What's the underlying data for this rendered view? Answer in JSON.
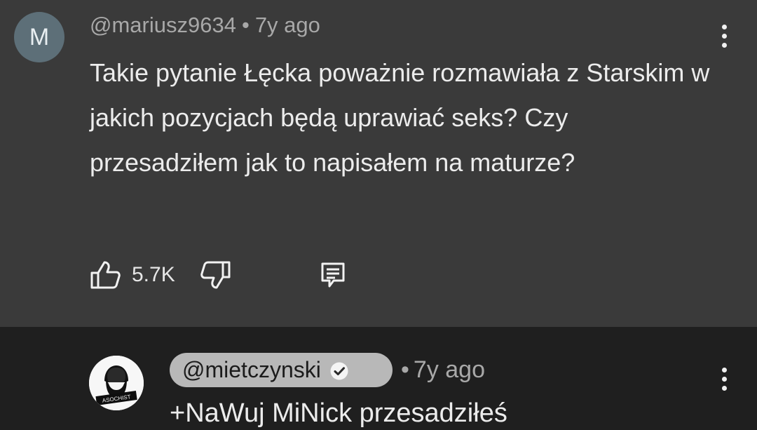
{
  "comment": {
    "avatar_letter": "M",
    "author": "@mariusz9634",
    "separator": "•",
    "time": "7y ago",
    "text": "Takie pytanie Łęcka poważnie rozmawiała z Starskim w jakich pozycjach będą uprawiać seks? Czy przesadziłem jak to napisałem na maturze?",
    "like_count": "5.7K"
  },
  "reply": {
    "author": "@mietczynski",
    "avatar_caption": "ASOCHIST",
    "separator": "•",
    "time": "7y ago",
    "text": "+NaWuj MiNick przesadziłeś"
  },
  "icons": {
    "like": "thumbs-up-icon",
    "dislike": "thumbs-down-icon",
    "reply": "reply-icon",
    "more": "more-vert-icon",
    "verified": "verified-check-icon"
  },
  "colors": {
    "comment_background": "#3a3a3a",
    "reply_background": "#1f1f1f",
    "avatar_background": "#5d6f78",
    "reply_author_chip": "#b8b8b8"
  }
}
